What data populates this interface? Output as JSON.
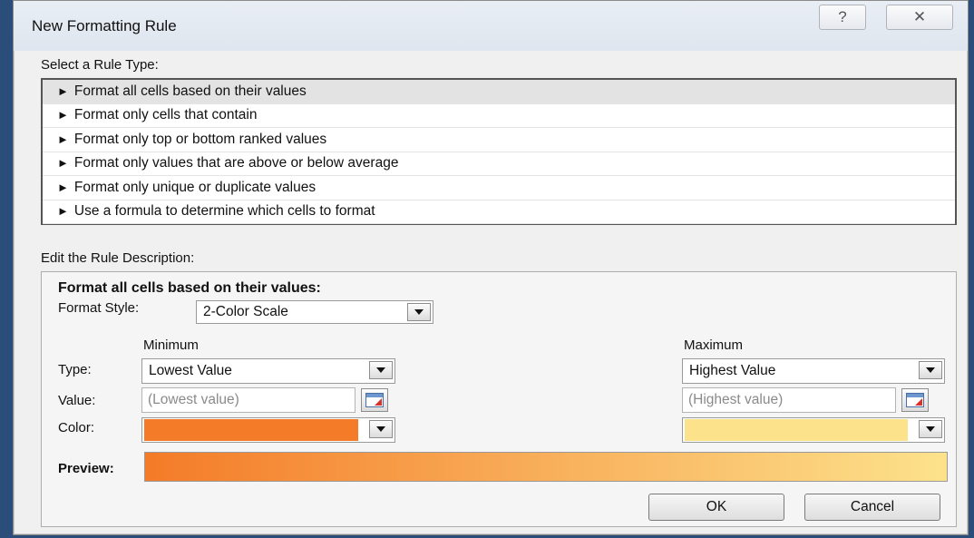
{
  "dialog": {
    "title": "New Formatting Rule",
    "help_glyph": "?",
    "close_glyph": "✕"
  },
  "rule_type": {
    "label": "Select a Rule Type:",
    "arrow_glyph": "►",
    "items": [
      {
        "label": "Format all cells based on their values",
        "selected": true
      },
      {
        "label": "Format only cells that contain",
        "selected": false
      },
      {
        "label": "Format only top or bottom ranked values",
        "selected": false
      },
      {
        "label": "Format only values that are above or below average",
        "selected": false
      },
      {
        "label": "Format only unique or duplicate values",
        "selected": false
      },
      {
        "label": "Use a formula to determine which cells to format",
        "selected": false
      }
    ]
  },
  "description": {
    "label": "Edit the Rule Description:",
    "heading": "Format all cells based on their values:",
    "format_style_label": "Format Style:",
    "format_style_value": "2-Color Scale",
    "minimum_label": "Minimum",
    "maximum_label": "Maximum",
    "type_label": "Type:",
    "value_label": "Value:",
    "color_label": "Color:",
    "min_type": "Lowest Value",
    "max_type": "Highest Value",
    "min_value_placeholder": "(Lowest value)",
    "max_value_placeholder": "(Highest value)",
    "min_color": "#f47b28",
    "max_color": "#fde28c",
    "preview_label": "Preview:"
  },
  "buttons": {
    "ok": "OK",
    "cancel": "Cancel"
  }
}
